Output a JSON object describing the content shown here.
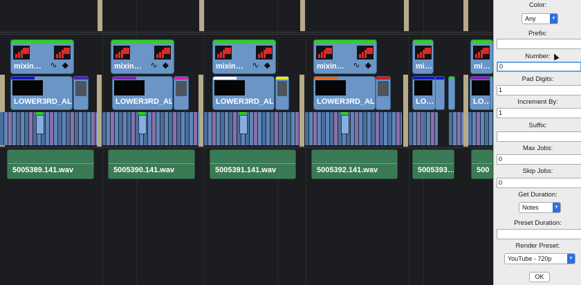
{
  "timeline": {
    "mixer_clips": [
      {
        "label": "mixin…",
        "icons": "∿ ◆"
      },
      {
        "label": "mixin…",
        "icons": "∿ ◆"
      },
      {
        "label": "mixin…",
        "icons": "∿ ◆"
      },
      {
        "label": "mixin…",
        "icons": "∿ ◆"
      },
      {
        "label": "mi…"
      },
      {
        "label": "mi…"
      }
    ],
    "lower_thirds": [
      {
        "label": "LOWER3RD_AL…",
        "tag_color": "#1414d0"
      },
      {
        "label": "LOWER3RD_AL…",
        "tag_color": "#8a1ec0"
      },
      {
        "label": "LOWER3RD_AL…",
        "tag_color": "#ffffff"
      },
      {
        "label": "LOWER3RD_AL…",
        "tag_color": "#f06414"
      },
      {
        "label": "LO…",
        "tag_color": "#1414d0"
      },
      {
        "label": "LO…",
        "tag_color": "#8a1ec0"
      }
    ],
    "audio_clips": [
      {
        "label": "5005389.141.wav"
      },
      {
        "label": "5005390.141.wav"
      },
      {
        "label": "5005391.141.wav"
      },
      {
        "label": "5005392.141.wav"
      },
      {
        "label": "5005393…"
      },
      {
        "label": "500"
      }
    ]
  },
  "sidebar": {
    "color_label": "Color:",
    "color_value": "Any",
    "prefix_label": "Prefix:",
    "prefix_value": "",
    "number_label": "Number:",
    "number_value": "0",
    "pad_digits_label": "Pad Digits:",
    "pad_digits_value": "1",
    "increment_label": "Increment By:",
    "increment_value": "1",
    "suffix_label": "Suffix:",
    "suffix_value": "",
    "max_jobs_label": "Max Jobs:",
    "max_jobs_value": "0",
    "skip_jobs_label": "Skip Jobs:",
    "skip_jobs_value": "0",
    "get_duration_label": "Get Duration:",
    "get_duration_value": "Notes",
    "preset_duration_label": "Preset Duration:",
    "preset_duration_value": "",
    "render_preset_label": "Render Preset:",
    "render_preset_value": "YouTube - 720p",
    "ok_label": "OK"
  },
  "colors": {
    "clip_blue": "#6a95c6",
    "clip_green": "#3a7a55",
    "accent_green": "#2fd21c",
    "accent_red": "#d92a2a",
    "select_blue": "#2f6fdc"
  }
}
